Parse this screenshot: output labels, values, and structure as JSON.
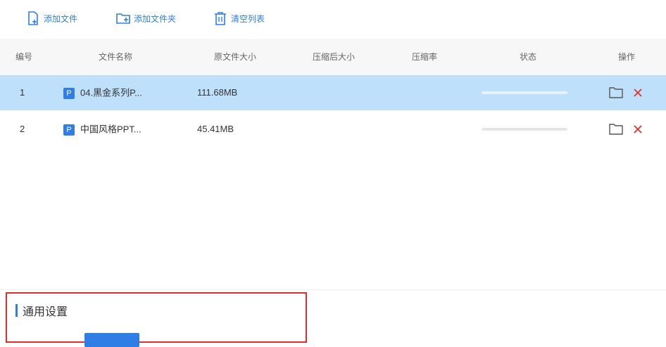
{
  "toolbar": {
    "add_file": "添加文件",
    "add_folder": "添加文件夹",
    "clear_list": "清空列表"
  },
  "table": {
    "headers": [
      "编号",
      "文件名称",
      "原文件大小",
      "压缩后大小",
      "压缩率",
      "状态",
      "操作"
    ],
    "rows": [
      {
        "index": "1",
        "badge": "P",
        "name": "04.黑金系列P...",
        "size": "111.68MB",
        "compressed": "",
        "ratio": "",
        "progress": 0,
        "selected": true
      },
      {
        "index": "2",
        "badge": "P",
        "name": "中国风格PPT...",
        "size": "45.41MB",
        "compressed": "",
        "ratio": "",
        "progress": 0,
        "selected": false
      }
    ]
  },
  "settings": {
    "title": "通用设置"
  },
  "colors": {
    "accent": "#2f7ee6",
    "selected_row": "#bfe0fb",
    "delete": "#e0322c",
    "highlight_border": "#e02e2e"
  },
  "icons": {
    "add_file": "add-file-icon",
    "add_folder": "add-folder-icon",
    "clear_list": "trash-icon",
    "file_type": "ppt-file-icon",
    "open_folder": "folder-icon",
    "delete": "close-icon"
  }
}
